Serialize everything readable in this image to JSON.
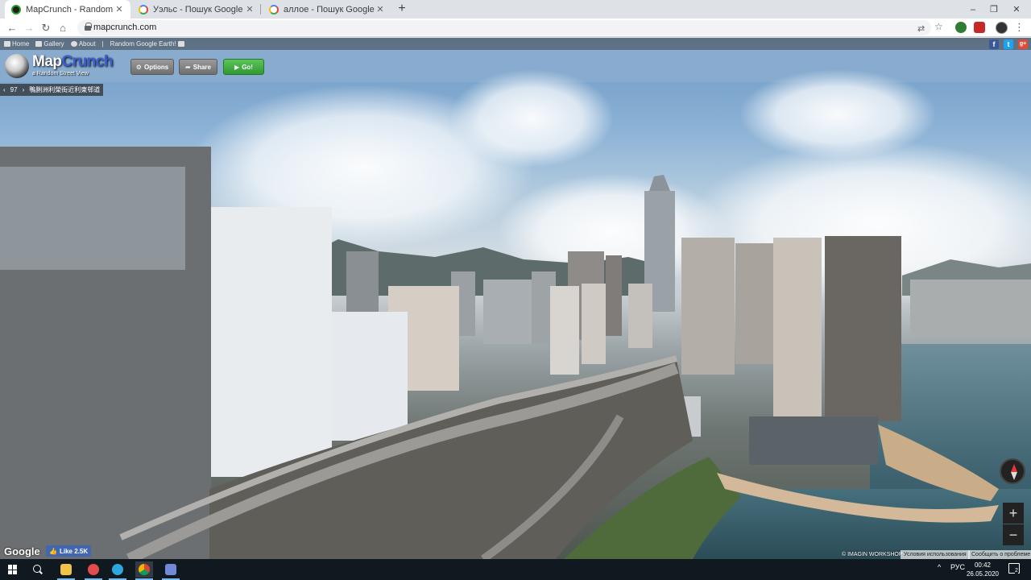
{
  "browser": {
    "tabs": [
      {
        "title": "MapCrunch - Random Street View",
        "favicon": "mapcrunch-favicon",
        "active": true
      },
      {
        "title": "Уэльс - Пошук Google",
        "favicon": "google-favicon",
        "active": false
      },
      {
        "title": "аллое - Пошук Google",
        "favicon": "google-favicon",
        "active": false
      }
    ],
    "new_tab_label": "+",
    "url": "mapcrunch.com",
    "window_controls": {
      "minimize": "–",
      "maximize": "❐",
      "close": "✕"
    }
  },
  "mapcrunch": {
    "nav": {
      "home": "Home",
      "gallery": "Gallery",
      "about": "About",
      "separator": "|",
      "random_earth": "Random Google Earth!"
    },
    "social": {
      "facebook": "f",
      "twitter": "t",
      "gplus": "g+"
    },
    "logo": {
      "map": "Map",
      "crunch": "Crunch",
      "subtitle": "a Random Street View"
    },
    "buttons": {
      "options": "Options",
      "share": "Share",
      "go": "Go!"
    },
    "location_bar": {
      "prev": "‹",
      "count": "97",
      "next": "›",
      "address": "鴨脷洲利榮街近利東邨道"
    }
  },
  "streetview": {
    "google_logo": "Google",
    "fb_like": "Like 2.5K",
    "attribution": "© IMAGIN WORKSHOP",
    "terms": "Условия использования",
    "report": "Сообщить о проблеме",
    "zoom_in": "+",
    "zoom_out": "−"
  },
  "taskbar": {
    "apps": [
      "file-explorer",
      "opera-browser",
      "telegram",
      "chrome",
      "discord"
    ],
    "tray": {
      "up_arrow": "^",
      "lang": "РУС"
    },
    "clock": {
      "time": "00:42",
      "date": "26.05.2020"
    },
    "notification_count": "2"
  },
  "colors": {
    "tab_strip": "#dee1e6",
    "taskbar": "#101820",
    "go_button": "#2f9a2f",
    "facebook": "#3b5998",
    "twitter": "#1da1f2",
    "gplus": "#dd4b39"
  }
}
